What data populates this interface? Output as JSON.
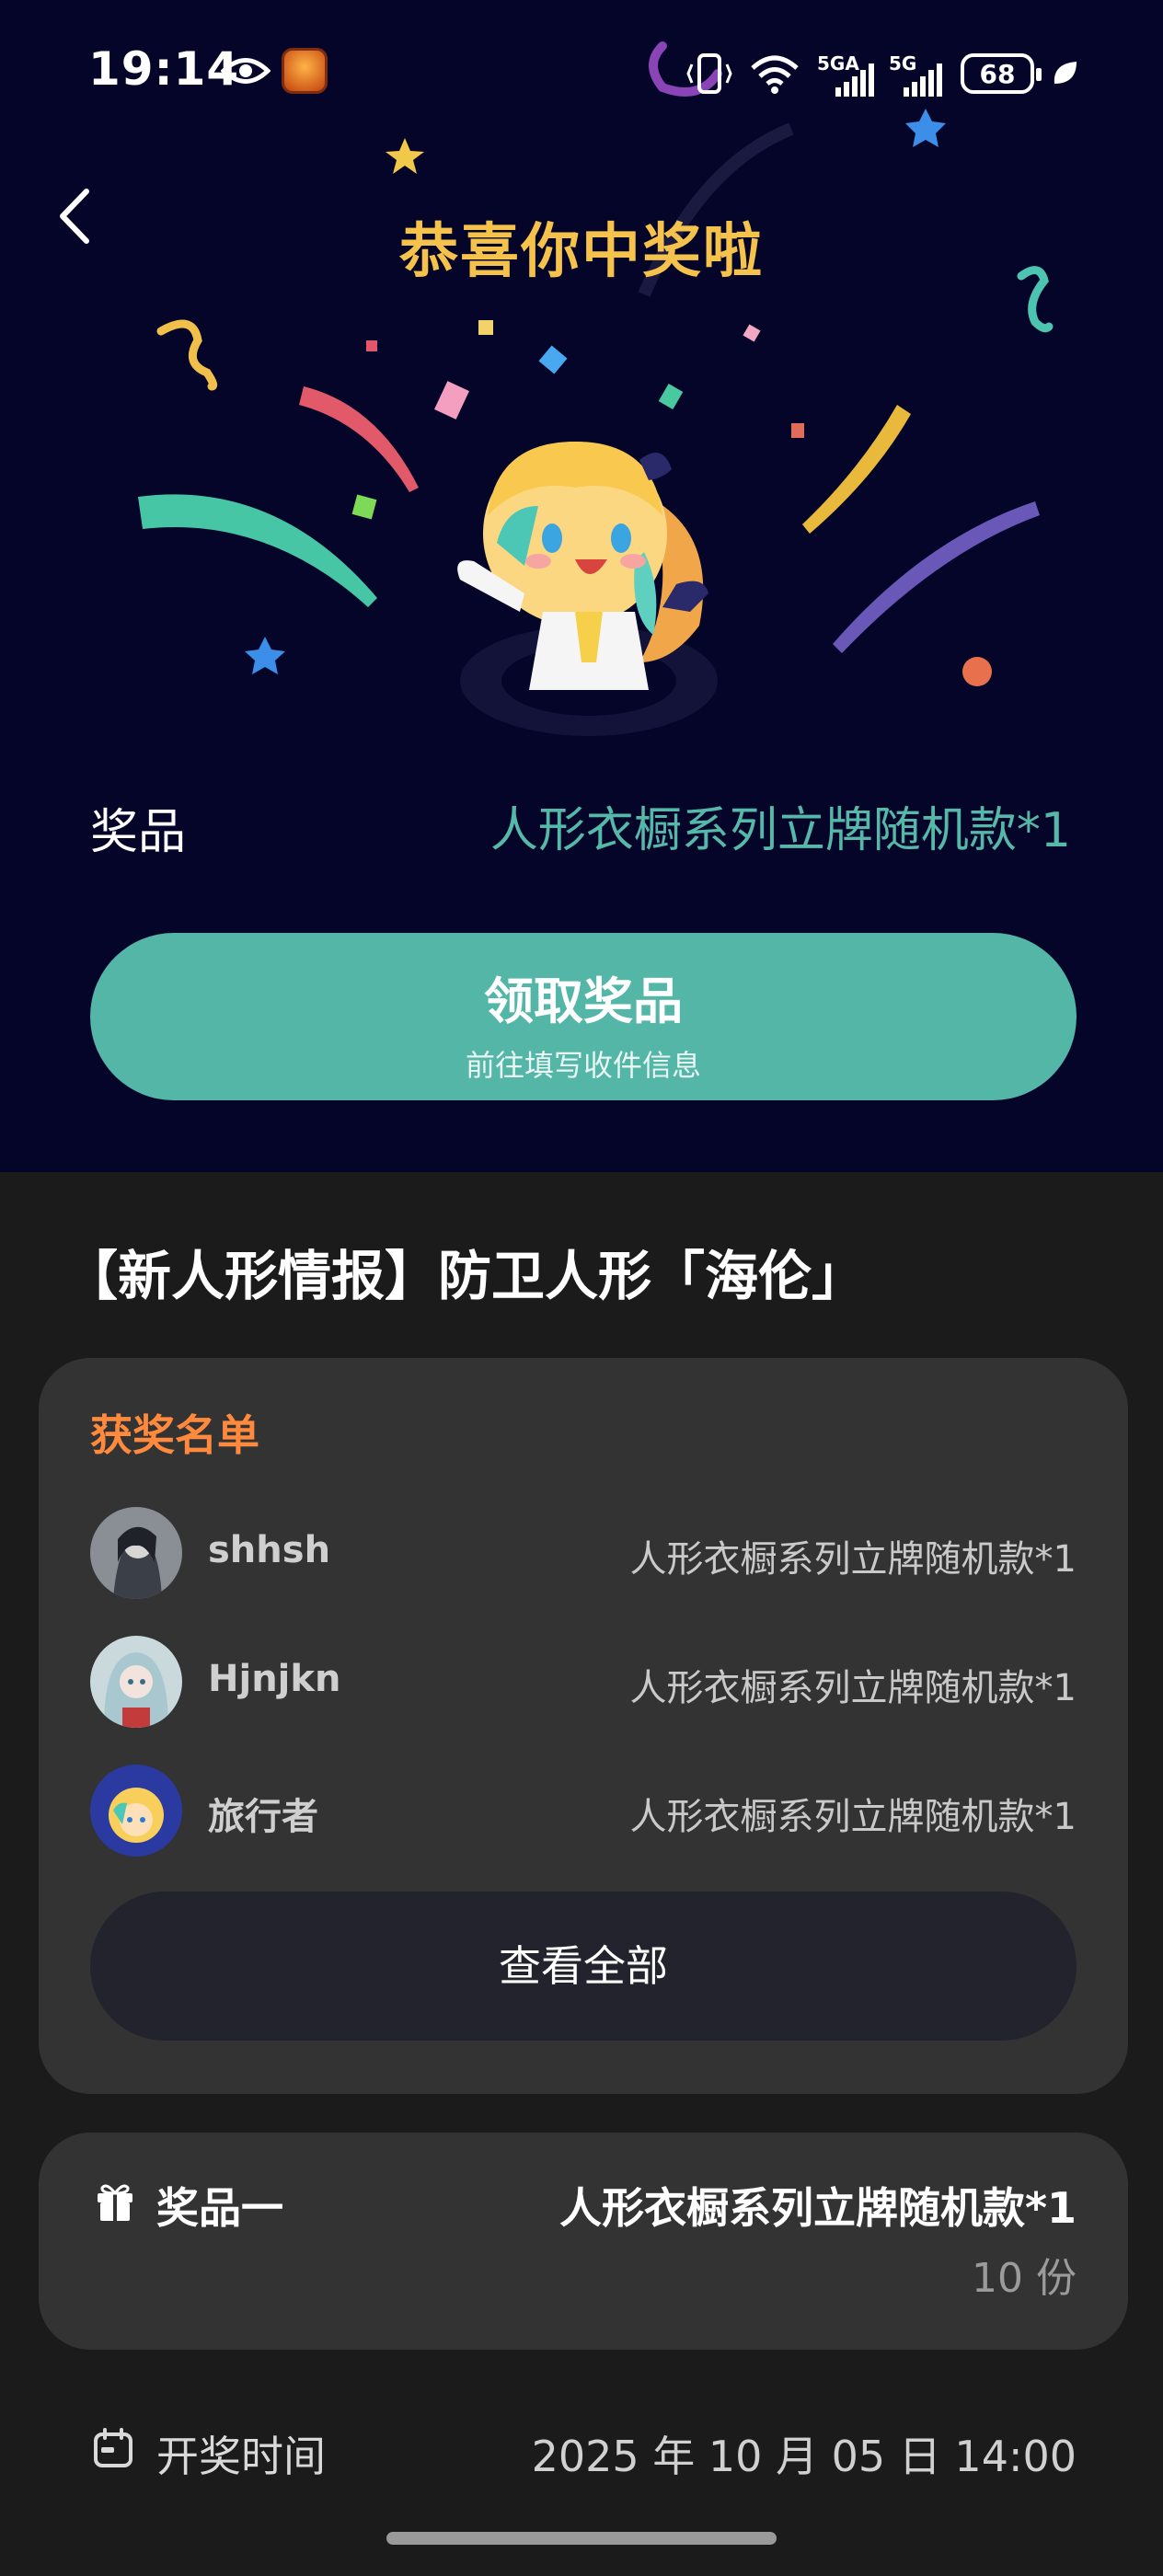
{
  "status_bar": {
    "time": "19:14",
    "network_1": "5GA",
    "network_2": "5G",
    "battery": "68"
  },
  "hero": {
    "title": "恭喜你中奖啦",
    "prize_label": "奖品",
    "prize_value": "人形衣橱系列立牌随机款*1",
    "claim_button": {
      "label": "领取奖品",
      "sublabel": "前往填写收件信息"
    }
  },
  "event": {
    "title": "【新人形情报】防卫人形「海伦」"
  },
  "winners": {
    "title": "获奖名单",
    "rows": [
      {
        "name": "shhsh",
        "prize": "人形衣橱系列立牌随机款*1"
      },
      {
        "name": "Hjnjkn",
        "prize": "人形衣橱系列立牌随机款*1"
      },
      {
        "name": "旅行者",
        "prize": "人形衣橱系列立牌随机款*1"
      }
    ],
    "view_all": "查看全部"
  },
  "prize_item": {
    "label": "奖品一",
    "value": "人形衣橱系列立牌随机款*1",
    "count": "10 份"
  },
  "draw_time": {
    "label": "开奖时间",
    "value": "2025 年 10 月 05 日 14:00"
  },
  "colors": {
    "hero_bg": "#05052a",
    "title_gold": "#f5c24b",
    "accent_teal": "#53b6a7",
    "winners_orange": "#ff8a3d",
    "card_bg": "#333334",
    "page_bg": "#1b1b1b"
  }
}
